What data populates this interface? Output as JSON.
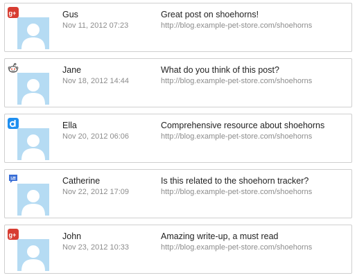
{
  "mentions": [
    {
      "name": "Gus",
      "date": "Nov 11, 2012 07:23",
      "message": "Great post on shoehorns!",
      "url": "http://blog.example-pet-store.com/shoehorns",
      "source_icon": "google-plus-icon"
    },
    {
      "name": "Jane",
      "date": "Nov 18, 2012 14:44",
      "message": "What do you think of this post?",
      "url": "http://blog.example-pet-store.com/shoehorns",
      "source_icon": "reddit-icon"
    },
    {
      "name": "Ella",
      "date": "Nov 20, 2012 06:06",
      "message": "Comprehensive resource about shoehorns",
      "url": "http://blog.example-pet-store.com/shoehorns",
      "source_icon": "delicious-d-icon"
    },
    {
      "name": "Catherine",
      "date": "Nov 22, 2012 17:09",
      "message": "Is this related to the shoehorn tracker?",
      "url": "http://blog.example-pet-store.com/shoehorns",
      "source_icon": "comment-bubble-icon"
    },
    {
      "name": "John",
      "date": "Nov 23, 2012 10:33",
      "message": "Amazing write-up, a must read",
      "url": "http://blog.example-pet-store.com/shoehorns",
      "source_icon": "google-plus-icon"
    }
  ],
  "colors": {
    "border": "#cfcfcf",
    "avatar_bg": "#b5dbf3",
    "avatar_fg": "#ffffff",
    "text": "#222222",
    "muted": "#8c8c8c",
    "google_plus": "#d73d32",
    "delicious": "#1f8ff0",
    "comment": "#3b6fd6"
  }
}
